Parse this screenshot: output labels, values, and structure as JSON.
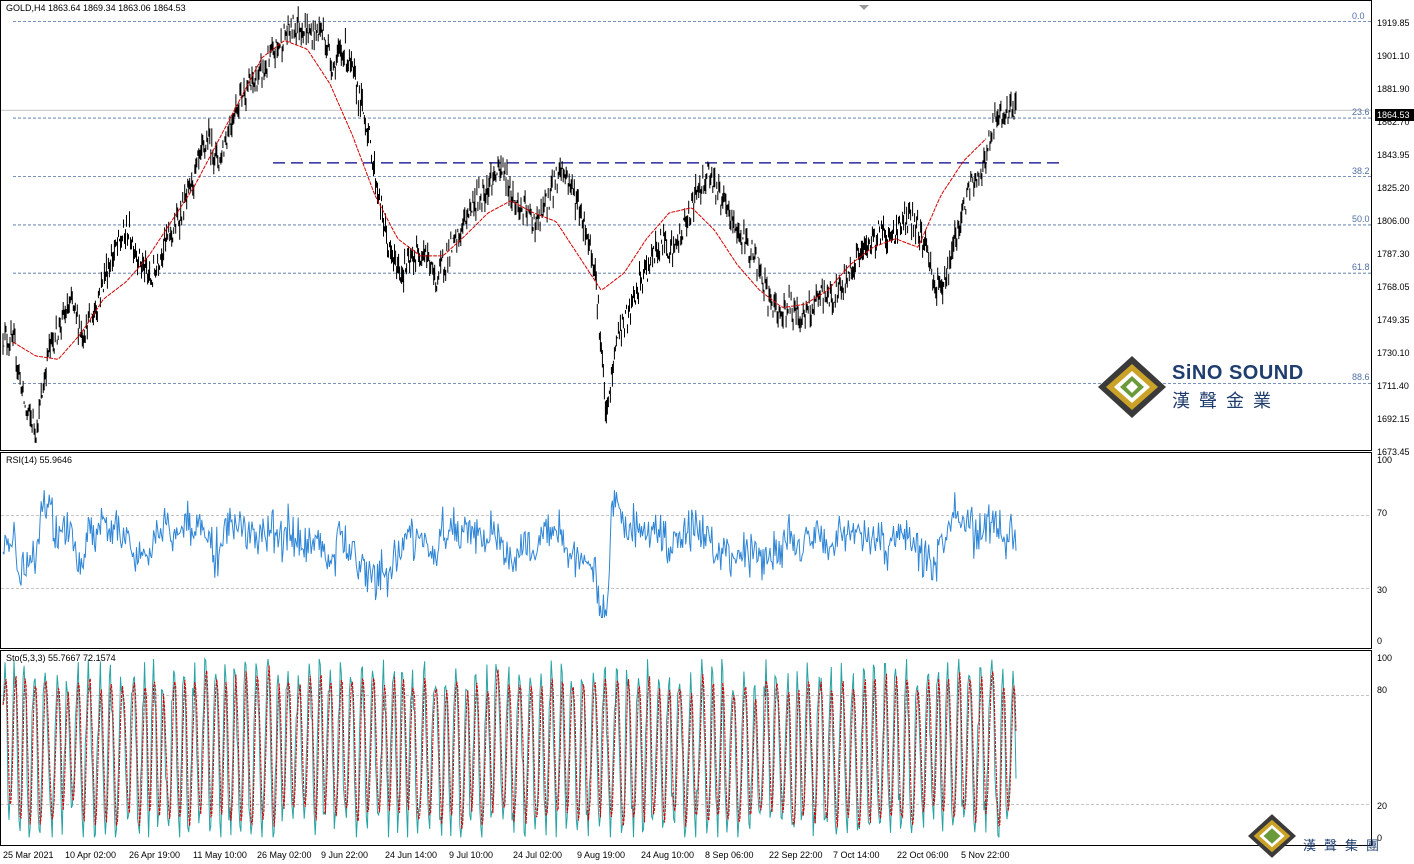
{
  "main": {
    "header": "GOLD,H4  1863.64 1869.34 1863.06 1864.53",
    "price_ticks": [
      "1919.85",
      "1901.10",
      "1881.90",
      "1862.70",
      "1843.95",
      "1825.20",
      "1806.00",
      "1787.30",
      "1768.05",
      "1749.35",
      "1730.10",
      "1711.40",
      "1692.15",
      "1673.45"
    ],
    "current_price": "1864.53",
    "fib_labels": [
      "0.0",
      "23.6",
      "38.2",
      "50.0",
      "61.8",
      "88.6"
    ]
  },
  "rsi": {
    "header": "RSI(14) 55.9646",
    "ticks": [
      "100",
      "70",
      "30",
      "0"
    ]
  },
  "sto": {
    "header": "Sto(5,3,3) 55.7667 72.1574",
    "ticks": [
      "100",
      "80",
      "20",
      "0"
    ]
  },
  "time_axis": [
    "25 Mar 2021",
    "10 Apr 02:00",
    "26 Apr 19:00",
    "11 May 10:00",
    "26 May 02:00",
    "9 Jun 22:00",
    "24 Jun 14:00",
    "9 Jul 10:00",
    "24 Jul 02:00",
    "9 Aug 19:00",
    "24 Aug 10:00",
    "8 Sep 06:00",
    "22 Sep 22:00",
    "7 Oct 14:00",
    "22 Oct 06:00",
    "5 Nov 22:00"
  ],
  "logo": {
    "brand_en": "SiNO SOUND",
    "brand_cn": "漢聲金業",
    "corner_cn": "漢聲集團"
  },
  "colors": {
    "price": "#000000",
    "ma": "#d40000",
    "rsi": "#2f86d6",
    "sto_main": "#2aa3a3",
    "sto_signal": "#d40000",
    "fib": "#4f6fa5",
    "resistance": "#00008b"
  },
  "chart_data": {
    "type": "line",
    "title": "GOLD,H4",
    "ohlc_last": {
      "open": 1863.64,
      "high": 1869.34,
      "low": 1863.06,
      "close": 1864.53
    },
    "x": [
      "25 Mar 2021",
      "10 Apr 02:00",
      "26 Apr 19:00",
      "11 May 10:00",
      "26 May 02:00",
      "9 Jun 22:00",
      "24 Jun 14:00",
      "9 Jul 10:00",
      "24 Jul 02:00",
      "9 Aug 19:00",
      "24 Aug 10:00",
      "8 Sep 06:00",
      "22 Sep 22:00",
      "7 Oct 14:00",
      "22 Oct 06:00",
      "5 Nov 22:00"
    ],
    "ylim": [
      1668,
      1925
    ],
    "price_path": [
      1735,
      1728,
      1690,
      1680,
      1725,
      1740,
      1752,
      1735,
      1747,
      1770,
      1785,
      1795,
      1778,
      1765,
      1785,
      1795,
      1810,
      1830,
      1848,
      1835,
      1858,
      1875,
      1880,
      1888,
      1900,
      1910,
      1915,
      1908,
      1912,
      1890,
      1900,
      1880,
      1855,
      1815,
      1780,
      1770,
      1778,
      1785,
      1765,
      1780,
      1790,
      1808,
      1815,
      1825,
      1830,
      1810,
      1805,
      1798,
      1815,
      1832,
      1820,
      1800,
      1775,
      1685,
      1735,
      1745,
      1765,
      1778,
      1790,
      1783,
      1800,
      1818,
      1830,
      1815,
      1800,
      1790,
      1780,
      1760,
      1745,
      1752,
      1745,
      1748,
      1758,
      1755,
      1765,
      1780,
      1785,
      1795,
      1790,
      1800,
      1800,
      1788,
      1760,
      1770,
      1800,
      1820,
      1830,
      1855,
      1862,
      1864
    ],
    "ma_path": [
      1730,
      1722,
      1720,
      1735,
      1755,
      1765,
      1780,
      1800,
      1820,
      1845,
      1870,
      1895,
      1905,
      1900,
      1880,
      1850,
      1815,
      1790,
      1780,
      1780,
      1792,
      1805,
      1812,
      1805,
      1800,
      1780,
      1760,
      1770,
      1790,
      1805,
      1808,
      1795,
      1775,
      1760,
      1750,
      1752,
      1760,
      1775,
      1785,
      1790,
      1785,
      1815,
      1835,
      1848
    ],
    "fib_levels": [
      {
        "label": "0.0",
        "value": 1916
      },
      {
        "label": "23.6",
        "value": 1860
      },
      {
        "label": "38.2",
        "value": 1826
      },
      {
        "label": "50.0",
        "value": 1798
      },
      {
        "label": "61.8",
        "value": 1770
      },
      {
        "label": "88.6",
        "value": 1706
      }
    ],
    "resistance": 1834,
    "rsi": {
      "name": "RSI(14)",
      "last": 55.9646,
      "ylim": [
        0,
        100
      ],
      "levels": [
        70,
        30
      ]
    },
    "stochastic": {
      "name": "Sto(5,3,3)",
      "main_last": 55.7667,
      "signal_last": 72.1574,
      "ylim": [
        0,
        100
      ],
      "levels": [
        80,
        20
      ]
    }
  }
}
